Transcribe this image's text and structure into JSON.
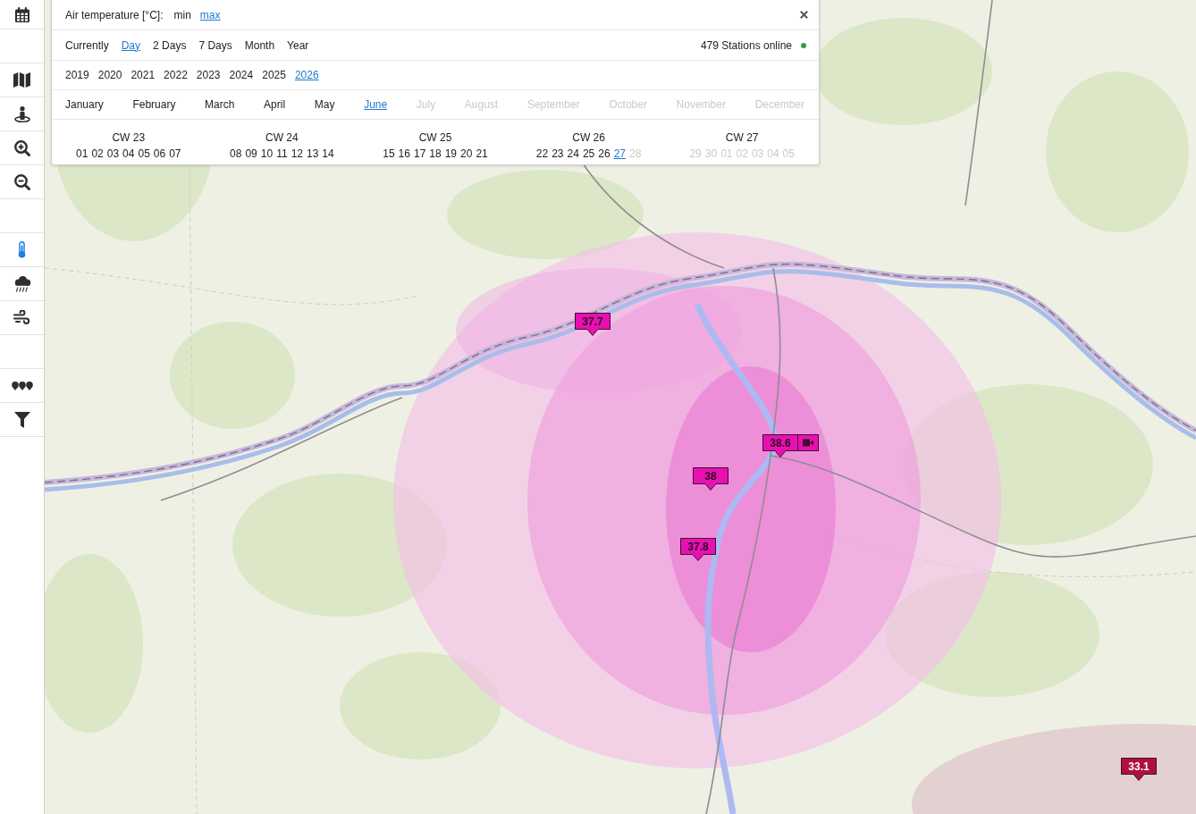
{
  "sidebar": {
    "groups": [
      {
        "items": [
          {
            "kind": "calendar",
            "selected": false
          }
        ]
      },
      {
        "items": [
          {
            "kind": "map",
            "selected": false
          },
          {
            "kind": "locate",
            "selected": false
          },
          {
            "kind": "zoom_in",
            "selected": false
          },
          {
            "kind": "zoom_out",
            "selected": false
          }
        ]
      },
      {
        "items": [
          {
            "kind": "temperature",
            "selected": true
          },
          {
            "kind": "precipitation",
            "selected": false
          },
          {
            "kind": "wind",
            "selected": false
          }
        ]
      },
      {
        "items": [
          {
            "kind": "stations",
            "selected": false
          },
          {
            "kind": "filter",
            "selected": false
          }
        ]
      }
    ]
  },
  "panel": {
    "title": "Air temperature [°C]:",
    "metrics": [
      {
        "label": "min",
        "selected": false
      },
      {
        "label": "max",
        "selected": true
      }
    ],
    "periods": [
      {
        "label": "Currently",
        "selected": false
      },
      {
        "label": "Day",
        "selected": true
      },
      {
        "label": "2 Days",
        "selected": false
      },
      {
        "label": "7 Days",
        "selected": false
      },
      {
        "label": "Month",
        "selected": false
      },
      {
        "label": "Year",
        "selected": false
      }
    ],
    "stations": {
      "label": "479 Stations online",
      "online": true
    },
    "years": [
      {
        "label": "2019",
        "selected": false
      },
      {
        "label": "2020",
        "selected": false
      },
      {
        "label": "2021",
        "selected": false
      },
      {
        "label": "2022",
        "selected": false
      },
      {
        "label": "2023",
        "selected": false
      },
      {
        "label": "2024",
        "selected": false
      },
      {
        "label": "2025",
        "selected": false
      },
      {
        "label": "2026",
        "selected": true
      }
    ],
    "months": [
      {
        "label": "January",
        "selected": false,
        "disabled": false
      },
      {
        "label": "February",
        "selected": false,
        "disabled": false
      },
      {
        "label": "March",
        "selected": false,
        "disabled": false
      },
      {
        "label": "April",
        "selected": false,
        "disabled": false
      },
      {
        "label": "May",
        "selected": false,
        "disabled": false
      },
      {
        "label": "June",
        "selected": true,
        "disabled": false
      },
      {
        "label": "July",
        "selected": false,
        "disabled": true
      },
      {
        "label": "August",
        "selected": false,
        "disabled": true
      },
      {
        "label": "September",
        "selected": false,
        "disabled": true
      },
      {
        "label": "October",
        "selected": false,
        "disabled": true
      },
      {
        "label": "November",
        "selected": false,
        "disabled": true
      },
      {
        "label": "December",
        "selected": false,
        "disabled": true
      }
    ],
    "weeks": [
      {
        "label": "CW 23",
        "days": [
          {
            "label": "01",
            "selected": false,
            "disabled": false
          },
          {
            "label": "02",
            "selected": false,
            "disabled": false
          },
          {
            "label": "03",
            "selected": false,
            "disabled": false
          },
          {
            "label": "04",
            "selected": false,
            "disabled": false
          },
          {
            "label": "05",
            "selected": false,
            "disabled": false
          },
          {
            "label": "06",
            "selected": false,
            "disabled": false
          },
          {
            "label": "07",
            "selected": false,
            "disabled": false
          }
        ]
      },
      {
        "label": "CW 24",
        "days": [
          {
            "label": "08",
            "selected": false,
            "disabled": false
          },
          {
            "label": "09",
            "selected": false,
            "disabled": false
          },
          {
            "label": "10",
            "selected": false,
            "disabled": false
          },
          {
            "label": "11",
            "selected": false,
            "disabled": false
          },
          {
            "label": "12",
            "selected": false,
            "disabled": false
          },
          {
            "label": "13",
            "selected": false,
            "disabled": false
          },
          {
            "label": "14",
            "selected": false,
            "disabled": false
          }
        ]
      },
      {
        "label": "CW 25",
        "days": [
          {
            "label": "15",
            "selected": false,
            "disabled": false
          },
          {
            "label": "16",
            "selected": false,
            "disabled": false
          },
          {
            "label": "17",
            "selected": false,
            "disabled": false
          },
          {
            "label": "18",
            "selected": false,
            "disabled": false
          },
          {
            "label": "19",
            "selected": false,
            "disabled": false
          },
          {
            "label": "20",
            "selected": false,
            "disabled": false
          },
          {
            "label": "21",
            "selected": false,
            "disabled": false
          }
        ]
      },
      {
        "label": "CW 26",
        "days": [
          {
            "label": "22",
            "selected": false,
            "disabled": false
          },
          {
            "label": "23",
            "selected": false,
            "disabled": false
          },
          {
            "label": "24",
            "selected": false,
            "disabled": false
          },
          {
            "label": "25",
            "selected": false,
            "disabled": false
          },
          {
            "label": "26",
            "selected": false,
            "disabled": false
          },
          {
            "label": "27",
            "selected": true,
            "disabled": false
          },
          {
            "label": "28",
            "selected": false,
            "disabled": true
          }
        ]
      },
      {
        "label": "CW 27",
        "days": [
          {
            "label": "29",
            "selected": false,
            "disabled": true
          },
          {
            "label": "30",
            "selected": false,
            "disabled": true
          },
          {
            "label": "01",
            "selected": false,
            "disabled": true
          },
          {
            "label": "02",
            "selected": false,
            "disabled": true
          },
          {
            "label": "03",
            "selected": false,
            "disabled": true
          },
          {
            "label": "04",
            "selected": false,
            "disabled": true
          },
          {
            "label": "05",
            "selected": false,
            "disabled": true
          }
        ]
      }
    ]
  },
  "map": {
    "markers": [
      {
        "value": "37.7",
        "color": "#e810b0",
        "webcam": false
      },
      {
        "value": "38.6",
        "color": "#e810b0",
        "webcam": true
      },
      {
        "value": "38",
        "color": "#e810b0",
        "webcam": false
      },
      {
        "value": "37.8",
        "color": "#e810b0",
        "webcam": false
      },
      {
        "value": "33.1",
        "color": "#b0103c",
        "webcam": false
      }
    ]
  }
}
